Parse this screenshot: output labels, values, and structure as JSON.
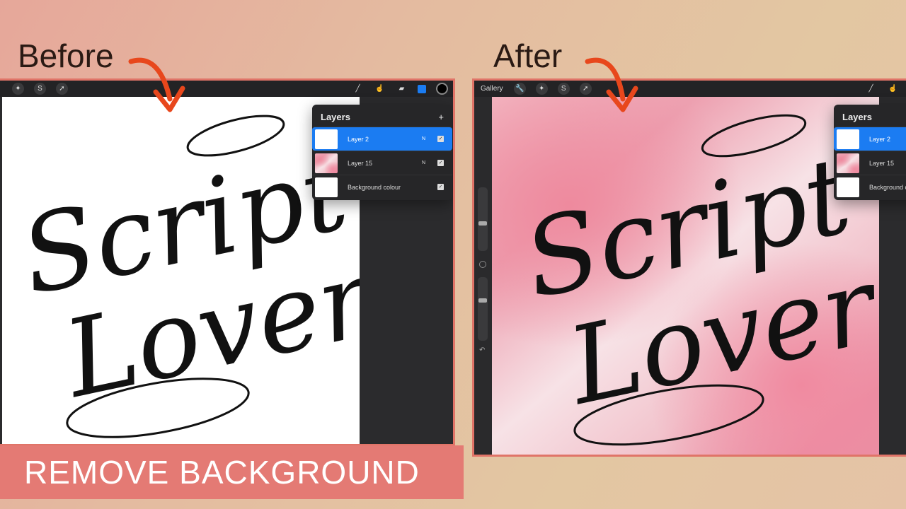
{
  "labels": {
    "before": "Before",
    "after": "After"
  },
  "banner": "REMOVE BACKGROUND",
  "artwork_text": {
    "line1": "Script",
    "line2": "Lover"
  },
  "before_panel": {
    "toolbar_left": [
      "magic-wand-icon",
      "selection-s-icon",
      "move-arrow-icon"
    ],
    "toolbar_right": [
      "brush-icon",
      "smudge-icon",
      "eraser-icon",
      "layers-icon",
      "color-icon"
    ],
    "layers": {
      "title": "Layers",
      "add": "+",
      "items": [
        {
          "name": "Layer 2",
          "mode": "N",
          "visible": true,
          "selected": true
        },
        {
          "name": "Layer 15",
          "mode": "N",
          "visible": true,
          "selected": false
        },
        {
          "name": "Background colour",
          "mode": "",
          "visible": true,
          "selected": false
        }
      ]
    }
  },
  "after_panel": {
    "gallery": "Gallery",
    "toolbar_left": [
      "wrench-icon",
      "magic-wand-icon",
      "selection-s-icon",
      "move-arrow-icon"
    ],
    "layers": {
      "title": "Layers",
      "items": [
        {
          "name": "Layer 2",
          "selected": true
        },
        {
          "name": "Layer 15",
          "selected": false
        },
        {
          "name": "Background colour",
          "selected": false
        }
      ]
    }
  },
  "colors": {
    "accent": "#e47a74",
    "arrow": "#e8471c",
    "selected_layer": "#1b7cf2"
  }
}
